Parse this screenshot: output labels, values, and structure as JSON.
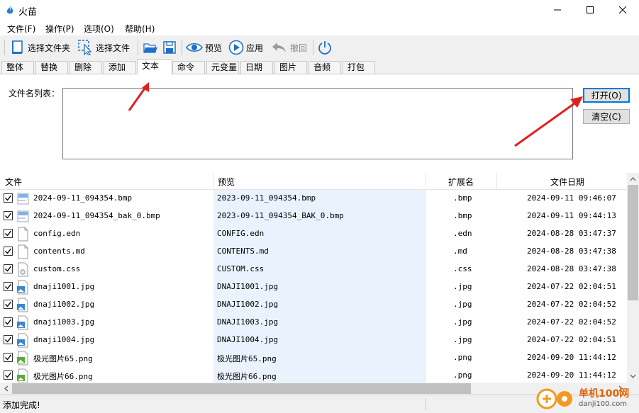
{
  "window": {
    "title": "火苗"
  },
  "menu": [
    "文件(F)",
    "操作(P)",
    "选项(O)",
    "帮助(H)"
  ],
  "toolbar": {
    "select_folder": "选择文件夹",
    "select_file": "选择文件",
    "preview": "预览",
    "apply": "应用",
    "undo": "撤回"
  },
  "tabs": [
    "整体",
    "替换",
    "删除",
    "添加",
    "文本",
    "命令",
    "元变量",
    "日期",
    "图片",
    "音频",
    "打包"
  ],
  "active_tab": "文本",
  "panel": {
    "filelist_label": "文件名列表：",
    "open_button": "打开(O)",
    "clear_button": "清空(C)"
  },
  "table": {
    "headers": [
      "文件",
      "预览",
      "扩展名",
      "文件日期"
    ],
    "rows": [
      {
        "checked": true,
        "icon": "bmp-image-icon",
        "file": "2024-09-11_094354.bmp",
        "preview": "2023-09-11_094354.bmp",
        "ext": ".bmp",
        "date": "2024-09-11 09:46:07"
      },
      {
        "checked": true,
        "icon": "bmp-image-icon",
        "file": "2024-09-11_094354_bak_0.bmp",
        "preview": "2023-09-11_094354_BAK_0.bmp",
        "ext": ".bmp",
        "date": "2024-09-11 09:44:13"
      },
      {
        "checked": true,
        "icon": "blank-file-icon",
        "file": "config.edn",
        "preview": "CONFIG.edn",
        "ext": ".edn",
        "date": "2024-08-28 03:47:37"
      },
      {
        "checked": true,
        "icon": "blank-file-icon",
        "file": "contents.md",
        "preview": "CONTENTS.md",
        "ext": ".md",
        "date": "2024-08-28 03:47:38"
      },
      {
        "checked": true,
        "icon": "css-file-icon",
        "file": "custom.css",
        "preview": "CUSTOM.css",
        "ext": ".css",
        "date": "2024-08-28 03:47:38"
      },
      {
        "checked": true,
        "icon": "jpg-image-icon",
        "file": "dnaji1001.jpg",
        "preview": "DNAJI1001.jpg",
        "ext": ".jpg",
        "date": "2024-07-22 02:04:51"
      },
      {
        "checked": true,
        "icon": "jpg-image-icon",
        "file": "dnaji1002.jpg",
        "preview": "DNAJI1002.jpg",
        "ext": ".jpg",
        "date": "2024-07-22 02:04:52"
      },
      {
        "checked": true,
        "icon": "jpg-image-icon",
        "file": "dnaji1003.jpg",
        "preview": "DNAJI1003.jpg",
        "ext": ".jpg",
        "date": "2024-07-22 02:04:52"
      },
      {
        "checked": true,
        "icon": "jpg-image-icon",
        "file": "dnaji1004.jpg",
        "preview": "DNAJI1004.jpg",
        "ext": ".jpg",
        "date": "2024-07-22 02:04:51"
      },
      {
        "checked": true,
        "icon": "png-image-icon",
        "file": "极光图片65.png",
        "preview": "极光图片65.png",
        "ext": ".png",
        "date": "2024-09-20 11:44:12"
      },
      {
        "checked": true,
        "icon": "png-image-icon",
        "file": "极光图片66.png",
        "preview": "极光图片66.png",
        "ext": ".png",
        "date": "2024-09-20 11:44:12"
      }
    ]
  },
  "status": {
    "message": "添加完成!"
  },
  "watermark": {
    "brand": "单机100网",
    "domain": "danji100.com"
  },
  "colors": {
    "accent": "#0078d7",
    "arrow": "#e02020",
    "preview_bg": "#eaf2fd"
  }
}
